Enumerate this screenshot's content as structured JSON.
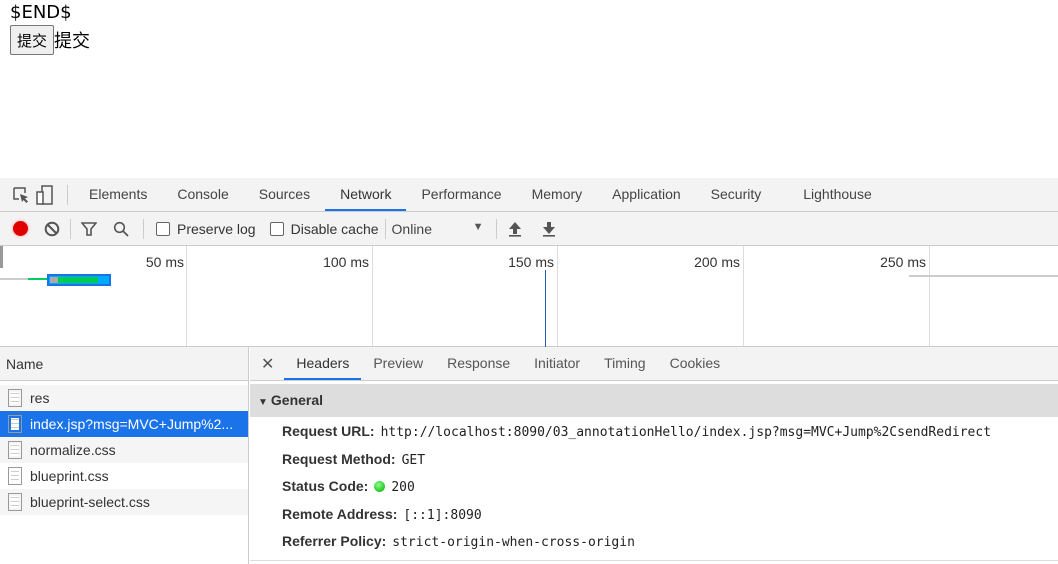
{
  "page": {
    "text": "$END$",
    "button_label": "提交",
    "after_button_text": "提交"
  },
  "devtools": {
    "tabs": [
      "Elements",
      "Console",
      "Sources",
      "Network",
      "Performance",
      "Memory",
      "Application",
      "Security",
      "Lighthouse"
    ],
    "active_tab": "Network",
    "toolbar": {
      "preserve_log": "Preserve log",
      "disable_cache": "Disable cache",
      "throttling": "Online",
      "preserve_log_checked": false,
      "disable_cache_checked": false,
      "record_color": "#e00000"
    },
    "timeline": {
      "ticks": [
        "50 ms",
        "100 ms",
        "150 ms",
        "200 ms",
        "250 ms"
      ]
    },
    "requests": {
      "header": "Name",
      "items": [
        "res",
        "index.jsp?msg=MVC+Jump%2...",
        "normalize.css",
        "blueprint.css",
        "blueprint-select.css"
      ],
      "selected": 1
    },
    "details": {
      "tabs": [
        "Headers",
        "Preview",
        "Response",
        "Initiator",
        "Timing",
        "Cookies"
      ],
      "active_tab": "Headers",
      "section": "General",
      "fields": [
        {
          "key": "Request URL:",
          "value": "http://localhost:8090/03_annotationHello/index.jsp?msg=MVC+Jump%2CsendRedirect"
        },
        {
          "key": "Request Method:",
          "value": "GET"
        },
        {
          "key": "Status Code:",
          "value": "200",
          "status_color": "#00aa00"
        },
        {
          "key": "Remote Address:",
          "value": "[::1]:8090"
        },
        {
          "key": "Referrer Policy:",
          "value": "strict-origin-when-cross-origin"
        }
      ]
    }
  }
}
